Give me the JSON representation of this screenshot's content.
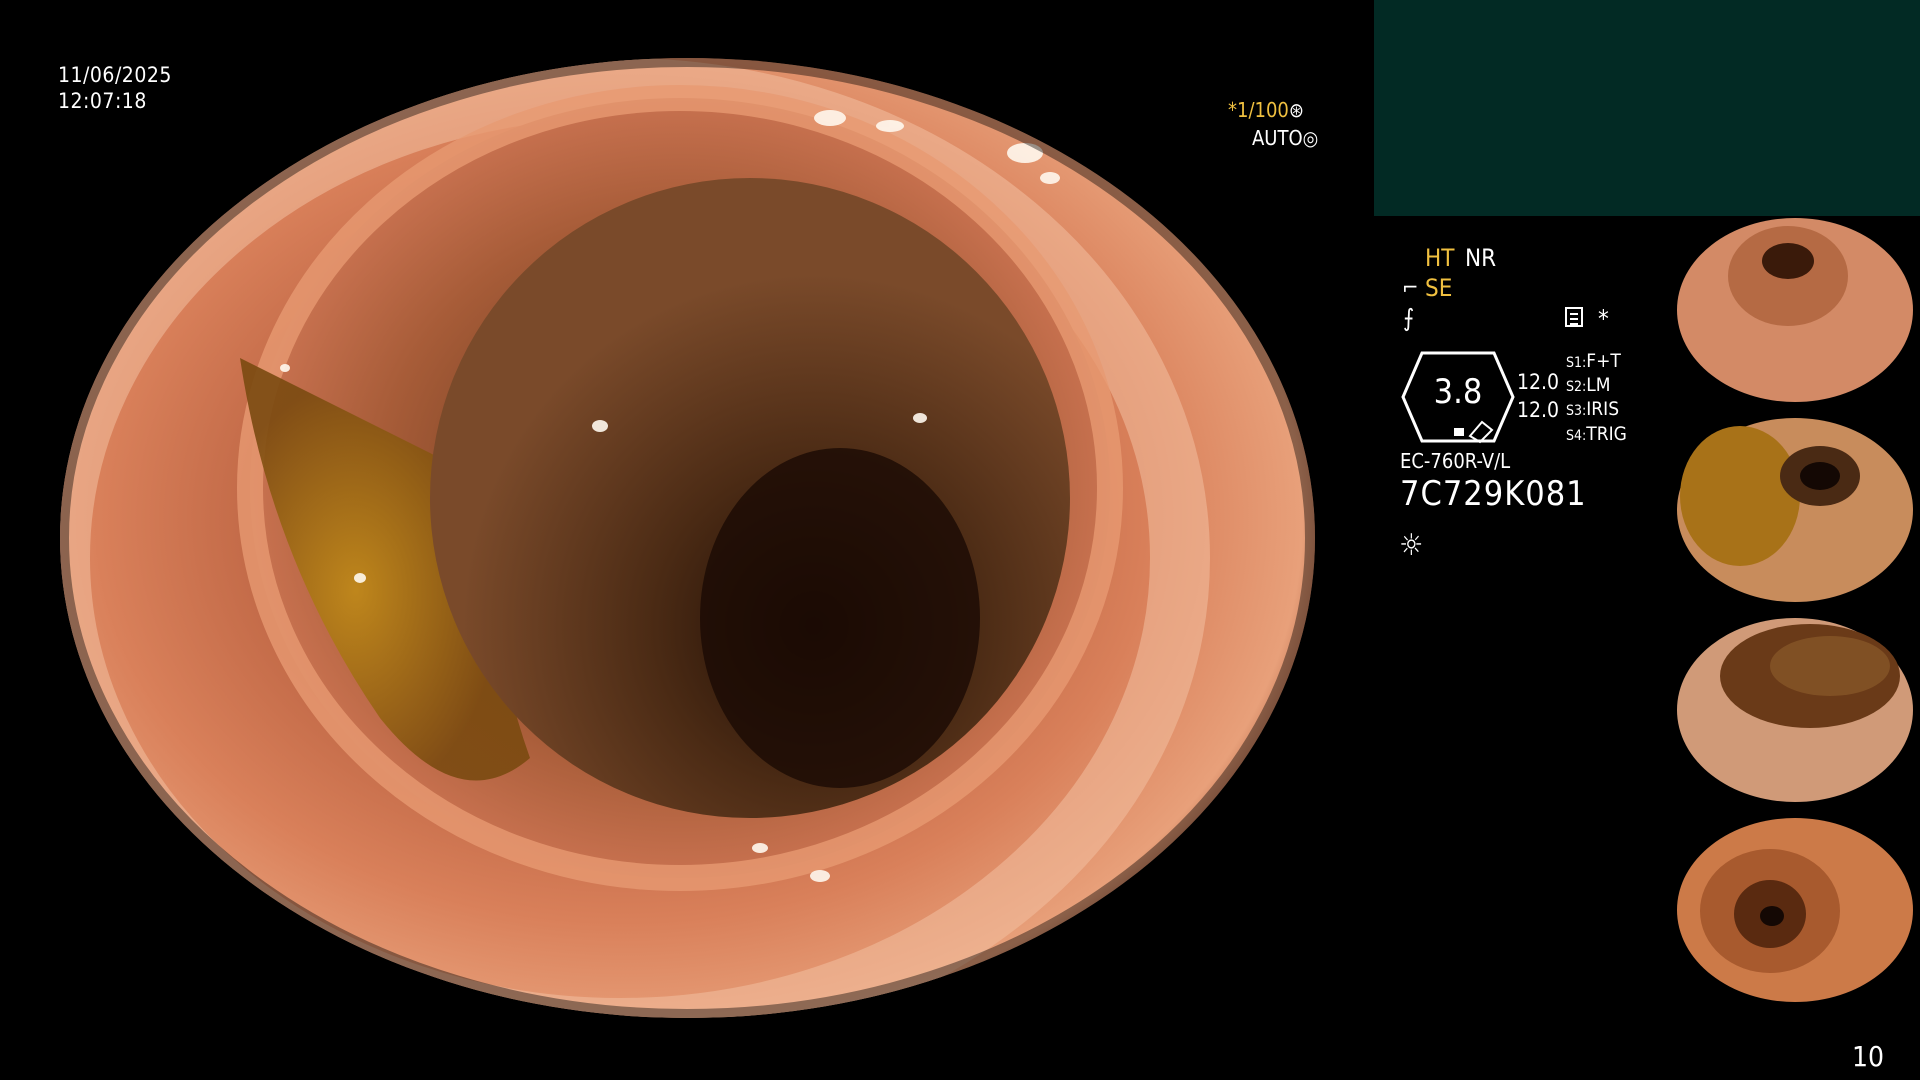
{
  "overlay": {
    "date": "11/06/2025",
    "time": "12:07:18",
    "shutter": "*1/100",
    "exposure_mode": "AUTO"
  },
  "panel": {
    "ht": "HT",
    "nr": "NR",
    "se": "SE",
    "asterisk": "*",
    "zoom_value": "3.8",
    "gain_1": "12.0",
    "gain_2": "12.0",
    "switches": [
      {
        "key": "S1:",
        "value": "F+T"
      },
      {
        "key": "S2:",
        "value": "LM"
      },
      {
        "key": "S3:",
        "value": "IRIS"
      },
      {
        "key": "S4:",
        "value": "TRIG"
      }
    ],
    "scope_model": "EC-760R-V/L",
    "scope_serial": "7C729K081"
  },
  "colors": {
    "accent_yellow": "#f0c040",
    "panel_teal": "#022a24",
    "mucosa": "#d9805a"
  },
  "icons": [
    "shutter-icon",
    "auto-iris-icon",
    "se-icon",
    "flash-icon",
    "memo-icon",
    "light-icon"
  ],
  "thumbnails": 4,
  "page_number": "10"
}
